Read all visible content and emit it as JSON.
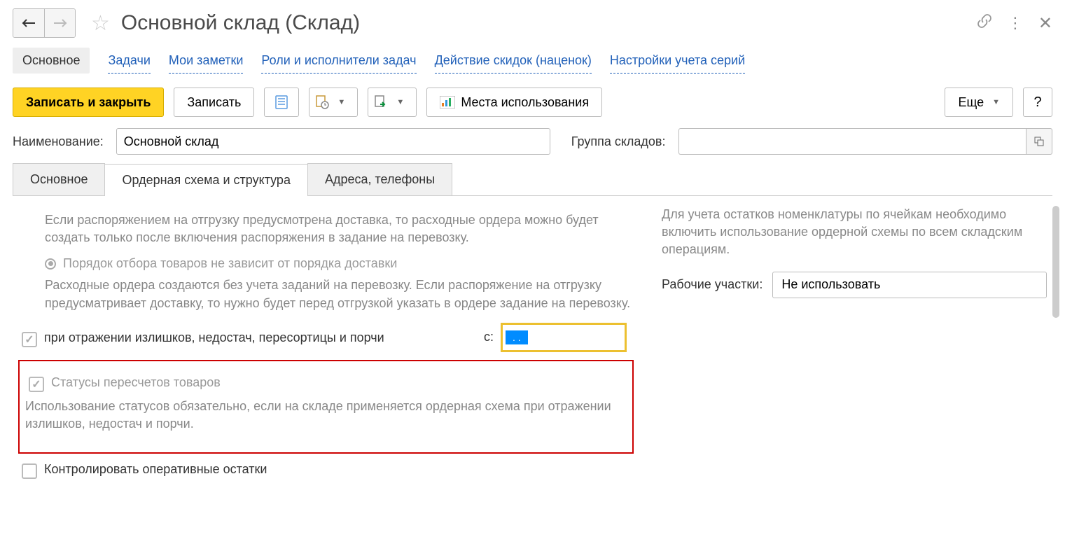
{
  "header": {
    "title": "Основной склад (Склад)"
  },
  "nav": {
    "main": "Основное",
    "tasks": "Задачи",
    "notes": "Мои заметки",
    "roles": "Роли и исполнители задач",
    "discounts": "Действие скидок (наценок)",
    "series": "Настройки учета серий"
  },
  "toolbar": {
    "save_close": "Записать и закрыть",
    "save": "Записать",
    "usage": "Места использования",
    "more": "Еще",
    "help": "?"
  },
  "form": {
    "name_label": "Наименование:",
    "name_value": "Основной склад",
    "group_label": "Группа складов:",
    "group_value": ""
  },
  "tabs": {
    "main": "Основное",
    "orders": "Ордерная схема и структура",
    "addresses": "Адреса, телефоны"
  },
  "content": {
    "delivery_desc": "Если распоряжением на отгрузку предусмотрена доставка, то расходные ордера можно будет создать только после включения распоряжения в задание на перевозку.",
    "radio_order": "Порядок отбора товаров не зависит от порядка доставки",
    "order_desc": "Расходные ордера создаются без учета заданий на перевозку. Если распоряжение на отгрузку предусматривает доставку, то нужно будет перед отгрузкой указать в ордере задание на перевозку.",
    "check_surplus": "при отражении излишков, недостач, пересортицы и порчи",
    "date_label": "с:",
    "date_value": " .  .  ",
    "status_label": "Статусы пересчетов товаров",
    "status_desc": "Использование статусов обязательно, если на складе применяется ордерная схема при отражении излишков, недостач и порчи.",
    "control_label": "Контролировать оперативные остатки",
    "right_desc": "Для учета остатков номенклатуры по ячейкам необходимо включить использование ордерной схемы по всем складским операциям.",
    "work_areas_label": "Рабочие участки:",
    "work_areas_value": "Не использовать"
  }
}
